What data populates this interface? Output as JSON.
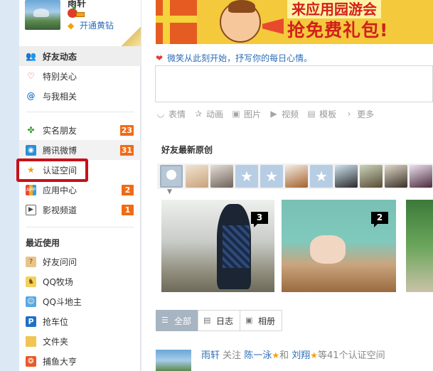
{
  "profile": {
    "name": "雨轩",
    "vip_link": "开通黄钻"
  },
  "nav": {
    "feed": "好友动态",
    "special_care": "特别关心",
    "mentions": "与我相关",
    "realname_friends": "实名朋友",
    "realname_count": "23",
    "weibo": "腾讯微博",
    "weibo_count": "31",
    "verified_space": "认证空间",
    "app_center": "应用中心",
    "app_center_count": "2",
    "video_channel": "影视频道",
    "video_count": "1"
  },
  "recent": {
    "title": "最近使用",
    "items": [
      "好友问问",
      "QQ牧场",
      "QQ斗地主",
      "抢车位",
      "文件夹",
      "捕鱼大亨"
    ]
  },
  "banner": {
    "line1": "来应用园游会",
    "line2": "抢免费礼包!"
  },
  "mood": {
    "text": "微笑从此刻开始，抒写你的每日心情。"
  },
  "toolbar": {
    "emoji": "表情",
    "animation": "动画",
    "image": "图片",
    "video": "视频",
    "template": "模板",
    "more": "更多"
  },
  "originals": {
    "title": "好友最新原创",
    "photo1_count": "3",
    "photo2_count": "2"
  },
  "tabs": {
    "all": "全部",
    "blog": "日志",
    "album": "相册"
  },
  "feed": {
    "user": "雨轩",
    "action": "关注",
    "user2": "陈一泳",
    "and": "和",
    "user3": "刘翔",
    "suffix": "等41个认证空间"
  },
  "colors": {
    "accent_blue": "#2b6db7",
    "count_orange": "#f26a14",
    "highlight_red": "#c8101a"
  }
}
